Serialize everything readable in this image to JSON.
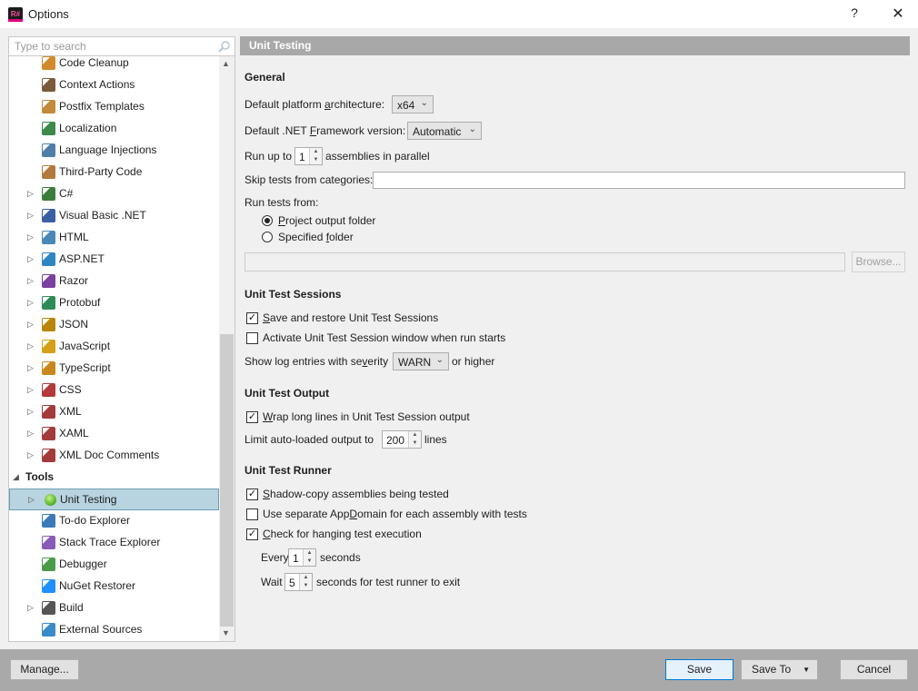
{
  "window": {
    "title": "Options",
    "app_icon_text": "R#",
    "help": "?",
    "close": "✕"
  },
  "search": {
    "placeholder": "Type to search"
  },
  "tree": [
    {
      "label": "Code Cleanup",
      "icon": "code-cleanup-icon",
      "color": "#d08a2c",
      "expand": false
    },
    {
      "label": "Context Actions",
      "icon": "hammer-icon",
      "color": "#7a5a3a",
      "expand": false
    },
    {
      "label": "Postfix Templates",
      "icon": "templates-icon",
      "color": "#c38a3b",
      "expand": false
    },
    {
      "label": "Localization",
      "icon": "localization-icon",
      "color": "#3d8a4a",
      "expand": false
    },
    {
      "label": "Language Injections",
      "icon": "syringe-icon",
      "color": "#4f7fa8",
      "expand": false
    },
    {
      "label": "Third-Party Code",
      "icon": "library-icon",
      "color": "#b07a3e",
      "expand": false
    },
    {
      "label": "C#",
      "icon": "csharp-icon",
      "color": "#3c7d3c",
      "expand": true
    },
    {
      "label": "Visual Basic .NET",
      "icon": "vb-icon",
      "color": "#3a5fa5",
      "expand": true
    },
    {
      "label": "HTML",
      "icon": "html-icon",
      "color": "#4a88b8",
      "expand": true
    },
    {
      "label": "ASP.NET",
      "icon": "aspnet-icon",
      "color": "#2e86c1",
      "expand": true
    },
    {
      "label": "Razor",
      "icon": "razor-icon",
      "color": "#7b3fa0",
      "expand": true
    },
    {
      "label": "Protobuf",
      "icon": "protobuf-icon",
      "color": "#2e8b57",
      "expand": true
    },
    {
      "label": "JSON",
      "icon": "json-icon",
      "color": "#b8860b",
      "expand": true
    },
    {
      "label": "JavaScript",
      "icon": "javascript-icon",
      "color": "#d4a017",
      "expand": true
    },
    {
      "label": "TypeScript",
      "icon": "typescript-icon",
      "color": "#c8881c",
      "expand": true
    },
    {
      "label": "CSS",
      "icon": "css-icon",
      "color": "#b23a3a",
      "expand": true
    },
    {
      "label": "XML",
      "icon": "xml-icon",
      "color": "#a33b3b",
      "expand": true
    },
    {
      "label": "XAML",
      "icon": "xaml-icon",
      "color": "#a33b3b",
      "expand": true
    },
    {
      "label": "XML Doc Comments",
      "icon": "xml-doc-icon",
      "color": "#a33b3b",
      "expand": true
    },
    {
      "label": "Tools",
      "section": true
    },
    {
      "label": "Unit Testing",
      "icon": "unit-testing-icon",
      "color": "#5cb82e",
      "expand": true,
      "selected": true
    },
    {
      "label": "To-do Explorer",
      "icon": "todo-icon",
      "color": "#3a7ab8",
      "expand": false
    },
    {
      "label": "Stack Trace Explorer",
      "icon": "stack-trace-icon",
      "color": "#8a5ab8",
      "expand": false
    },
    {
      "label": "Debugger",
      "icon": "debugger-icon",
      "color": "#4a9a4a",
      "expand": false
    },
    {
      "label": "NuGet Restorer",
      "icon": "nuget-icon",
      "color": "#1e90ff",
      "expand": false
    },
    {
      "label": "Build",
      "icon": "build-icon",
      "color": "#555555",
      "expand": true
    },
    {
      "label": "External Sources",
      "icon": "external-sources-icon",
      "color": "#3a8ac8",
      "expand": false
    }
  ],
  "panel": {
    "title": "Unit Testing",
    "general": {
      "heading": "General",
      "platform_label": "Default platform architecture:",
      "platform_value": "x64",
      "framework_label": "Default .NET Framework version:",
      "framework_value": "Automatic",
      "run_up_to": "Run up to",
      "parallel_value": "1",
      "parallel_suffix": "assemblies in parallel",
      "skip_label": "Skip tests from categories:",
      "skip_value": "",
      "run_from_label": "Run tests from:",
      "radio_project": "Project output folder",
      "radio_specified": "Specified folder",
      "folder_value": "",
      "browse": "Browse..."
    },
    "sessions": {
      "heading": "Unit Test Sessions",
      "save_restore": "Save and restore Unit Test Sessions",
      "save_restore_checked": true,
      "activate": "Activate Unit Test Session window when run starts",
      "activate_checked": false,
      "log_label": "Show log entries with severity",
      "log_value": "WARN",
      "log_suffix": "or higher"
    },
    "output": {
      "heading": "Unit Test Output",
      "wrap": "Wrap long lines in Unit Test Session output",
      "wrap_checked": true,
      "limit_label": "Limit auto-loaded output to",
      "limit_value": "200",
      "limit_suffix": "lines"
    },
    "runner": {
      "heading": "Unit Test Runner",
      "shadow": "Shadow-copy assemblies being tested",
      "shadow_checked": true,
      "appdomain": "Use separate AppDomain for each assembly with tests",
      "appdomain_checked": false,
      "hanging": "Check for hanging test execution",
      "hanging_checked": true,
      "every_label": "Every",
      "every_value": "1",
      "every_suffix": "seconds",
      "wait_label": "Wait",
      "wait_value": "5",
      "wait_suffix": "seconds for test runner to exit"
    }
  },
  "footer": {
    "manage": "Manage...",
    "save": "Save",
    "save_to": "Save To",
    "cancel": "Cancel"
  }
}
